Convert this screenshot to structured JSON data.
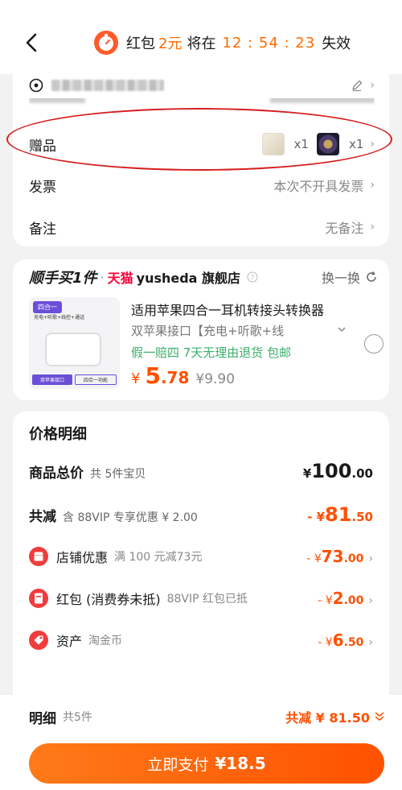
{
  "header": {
    "timer_label": "红包",
    "timer_amount": "2元",
    "timer_mid": "将在",
    "timer_clock": "12 : 54 : 23",
    "timer_suffix": "失效"
  },
  "order_info": {
    "gift_label": "赠品",
    "gift_qty_1": "x1",
    "gift_qty_2": "x1",
    "invoice_label": "发票",
    "invoice_value": "本次不开具发票",
    "note_label": "备注",
    "note_value": "无备注"
  },
  "addon": {
    "brand": "顺手买1件",
    "dot": "·",
    "platform": "天猫",
    "shop_name": "yusheda 旗舰店",
    "swap_label": "换一换",
    "product_title": "适用苹果四合一耳机转接头转换器",
    "product_spec": "双苹果接口【充电+听歌+线",
    "product_services": "假一赔四 7天无理由退货 包邮",
    "price_currency": "¥",
    "price_int": "5",
    "price_dec": ".78",
    "price_original": "¥9.90",
    "image_tag": "四合一",
    "image_sub": "充电+听歌+线控+通话",
    "image_foot_1": "双苹果接口",
    "image_foot_2": "四合一功能"
  },
  "price_detail": {
    "title": "价格明细",
    "goods_label": "商品总价",
    "goods_note": "共 5件宝贝",
    "goods_cur": "¥",
    "goods_int": "100",
    "goods_dec": ".00",
    "discount_label": "共减",
    "discount_note": "含 88VIP 专享优惠 ¥ 2.00",
    "discount_cur": "- ¥",
    "discount_int": "81",
    "discount_dec": ".50",
    "items": [
      {
        "label": "店铺优惠",
        "note": "满 100 元减73元",
        "cur": "- ¥",
        "int": "73",
        "dec": ".00"
      },
      {
        "label": "红包 (消费券未抵)",
        "note": "88VIP 红包已抵",
        "cur": "- ¥",
        "int": "2",
        "dec": ".00"
      },
      {
        "label": "资产",
        "note": "淘金币",
        "cur": "- ¥",
        "int": "6",
        "dec": ".50"
      }
    ]
  },
  "footer": {
    "detail_label": "明细",
    "detail_count": "共5件",
    "detail_saving": "共减 ¥ 81.50",
    "pay_label": "立即支付",
    "pay_amount": "¥18.5"
  },
  "colors": {
    "accent": "#ff5000",
    "green": "#3ab06a",
    "tmall": "#ff0036",
    "highlight_oval": "#d61f1f"
  }
}
